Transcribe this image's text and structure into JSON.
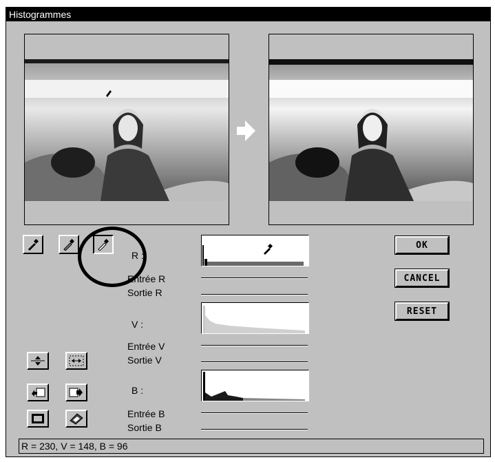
{
  "window": {
    "title": "Histogrammes"
  },
  "channels": {
    "r": {
      "label": "R :",
      "input_label": "Entrée R",
      "output_label": "Sortie R"
    },
    "v": {
      "label": "V :",
      "input_label": "Entrée V",
      "output_label": "Sortie V"
    },
    "b": {
      "label": "B :",
      "input_label": "Entrée B",
      "output_label": "Sortie B"
    }
  },
  "buttons": {
    "ok": "OK",
    "cancel": "CANCEL",
    "reset": "RESET"
  },
  "status": {
    "text": "R = 230, V = 148, B = 96"
  },
  "icons": {
    "eyedropper_black": "eyedropper-black-icon",
    "eyedropper_gray": "eyedropper-gray-icon",
    "eyedropper_white": "eyedropper-white-icon",
    "arrow": "arrow-right-icon"
  },
  "colors": {
    "titlebar": "#000000",
    "window_bg": "#c0c0c0"
  }
}
